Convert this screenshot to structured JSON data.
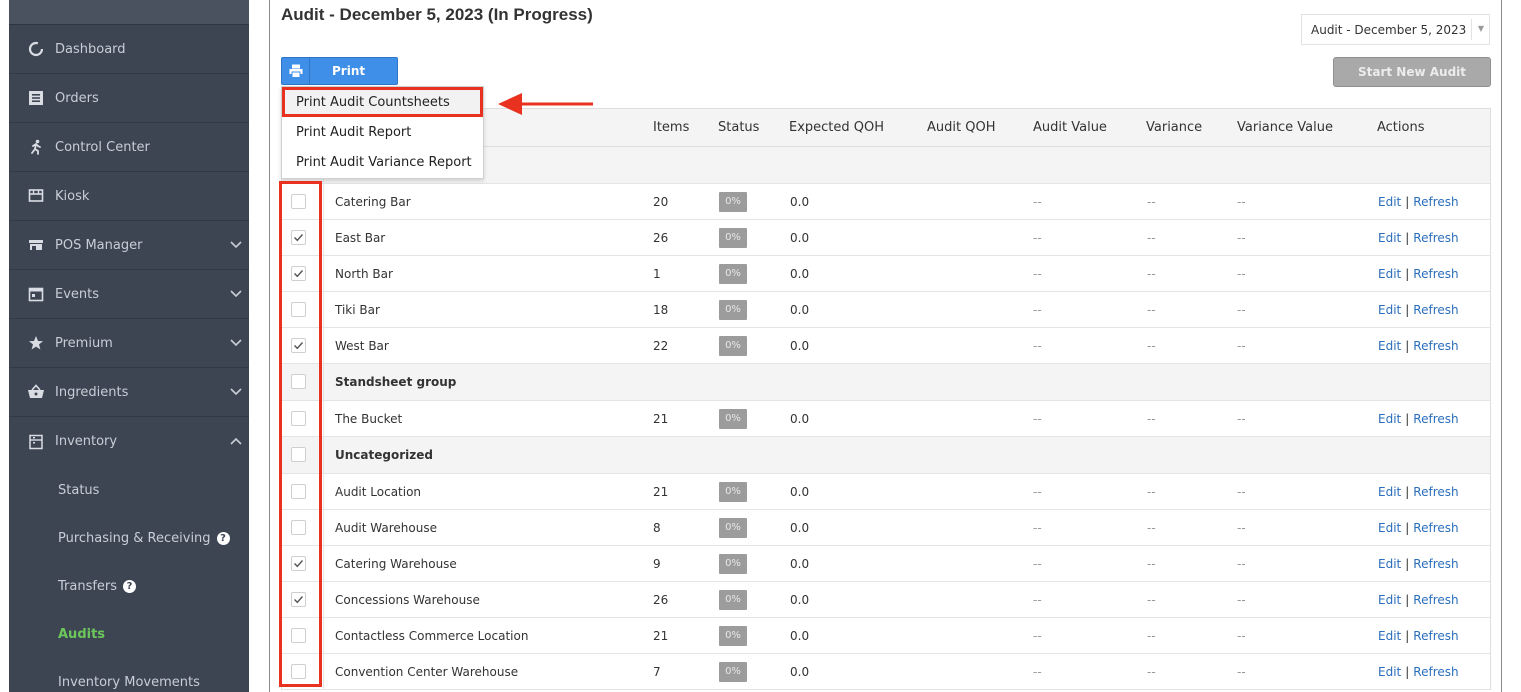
{
  "sidebar": {
    "items": [
      {
        "label": "Dashboard",
        "icon": "circle-notch-icon"
      },
      {
        "label": "Orders",
        "icon": "list-icon"
      },
      {
        "label": "Control Center",
        "icon": "running-person-icon"
      },
      {
        "label": "Kiosk",
        "icon": "kiosk-icon"
      },
      {
        "label": "POS Manager",
        "icon": "store-icon"
      },
      {
        "label": "Events",
        "icon": "calendar-icon"
      },
      {
        "label": "Premium",
        "icon": "star-icon"
      },
      {
        "label": "Ingredients",
        "icon": "basket-icon"
      },
      {
        "label": "Inventory",
        "icon": "inventory-icon"
      }
    ],
    "inventory_sub": [
      {
        "label": "Status"
      },
      {
        "label": "Purchasing & Receiving",
        "help": "?"
      },
      {
        "label": "Transfers",
        "help": "?"
      },
      {
        "label": "Audits"
      },
      {
        "label": "Inventory Movements"
      }
    ]
  },
  "header": {
    "title": "Audit - December 5, 2023 (In Progress)",
    "audit_select_value": "Audit - December 5, 2023",
    "print_label": "Print",
    "start_new_label": "Start New Audit"
  },
  "print_menu": [
    "Print Audit Countsheets",
    "Print Audit Report",
    "Print Audit Variance Report"
  ],
  "table": {
    "columns": {
      "items": "Items",
      "status": "Status",
      "expected_qoh": "Expected QOH",
      "audit_qoh": "Audit QOH",
      "audit_value": "Audit Value",
      "variance": "Variance",
      "variance_value": "Variance Value",
      "actions": "Actions"
    },
    "rows_group1": [
      {
        "name": "Catering Bar",
        "items": "20",
        "status": "0%",
        "expected": "0.0",
        "checked": false
      },
      {
        "name": "East Bar",
        "items": "26",
        "status": "0%",
        "expected": "0.0",
        "checked": true
      },
      {
        "name": "North Bar",
        "items": "1",
        "status": "0%",
        "expected": "0.0",
        "checked": true
      },
      {
        "name": "Tiki Bar",
        "items": "18",
        "status": "0%",
        "expected": "0.0",
        "checked": false
      },
      {
        "name": "West Bar",
        "items": "22",
        "status": "0%",
        "expected": "0.0",
        "checked": true
      }
    ],
    "group2": "Standsheet group",
    "rows_group2": [
      {
        "name": "The Bucket",
        "items": "21",
        "status": "0%",
        "expected": "0.0",
        "checked": false
      }
    ],
    "group3": "Uncategorized",
    "rows_group3": [
      {
        "name": "Audit Location",
        "items": "21",
        "status": "0%",
        "expected": "0.0",
        "checked": false
      },
      {
        "name": "Audit Warehouse",
        "items": "8",
        "status": "0%",
        "expected": "0.0",
        "checked": false
      },
      {
        "name": "Catering Warehouse",
        "items": "9",
        "status": "0%",
        "expected": "0.0",
        "checked": true
      },
      {
        "name": "Concessions Warehouse",
        "items": "26",
        "status": "0%",
        "expected": "0.0",
        "checked": true
      },
      {
        "name": "Contactless Commerce Location",
        "items": "21",
        "status": "0%",
        "expected": "0.0",
        "checked": false
      },
      {
        "name": "Convention Center Warehouse",
        "items": "7",
        "status": "0%",
        "expected": "0.0",
        "checked": false
      }
    ],
    "dash": "--",
    "edit_label": "Edit",
    "pipe": "|",
    "refresh_label": "Refresh"
  },
  "colors": {
    "sidebar_bg": "#3d4553",
    "active_green": "#6bc75b",
    "print_blue": "#3f8ee8",
    "annotation_red": "#e8321f",
    "link_blue": "#2a6ebb"
  }
}
